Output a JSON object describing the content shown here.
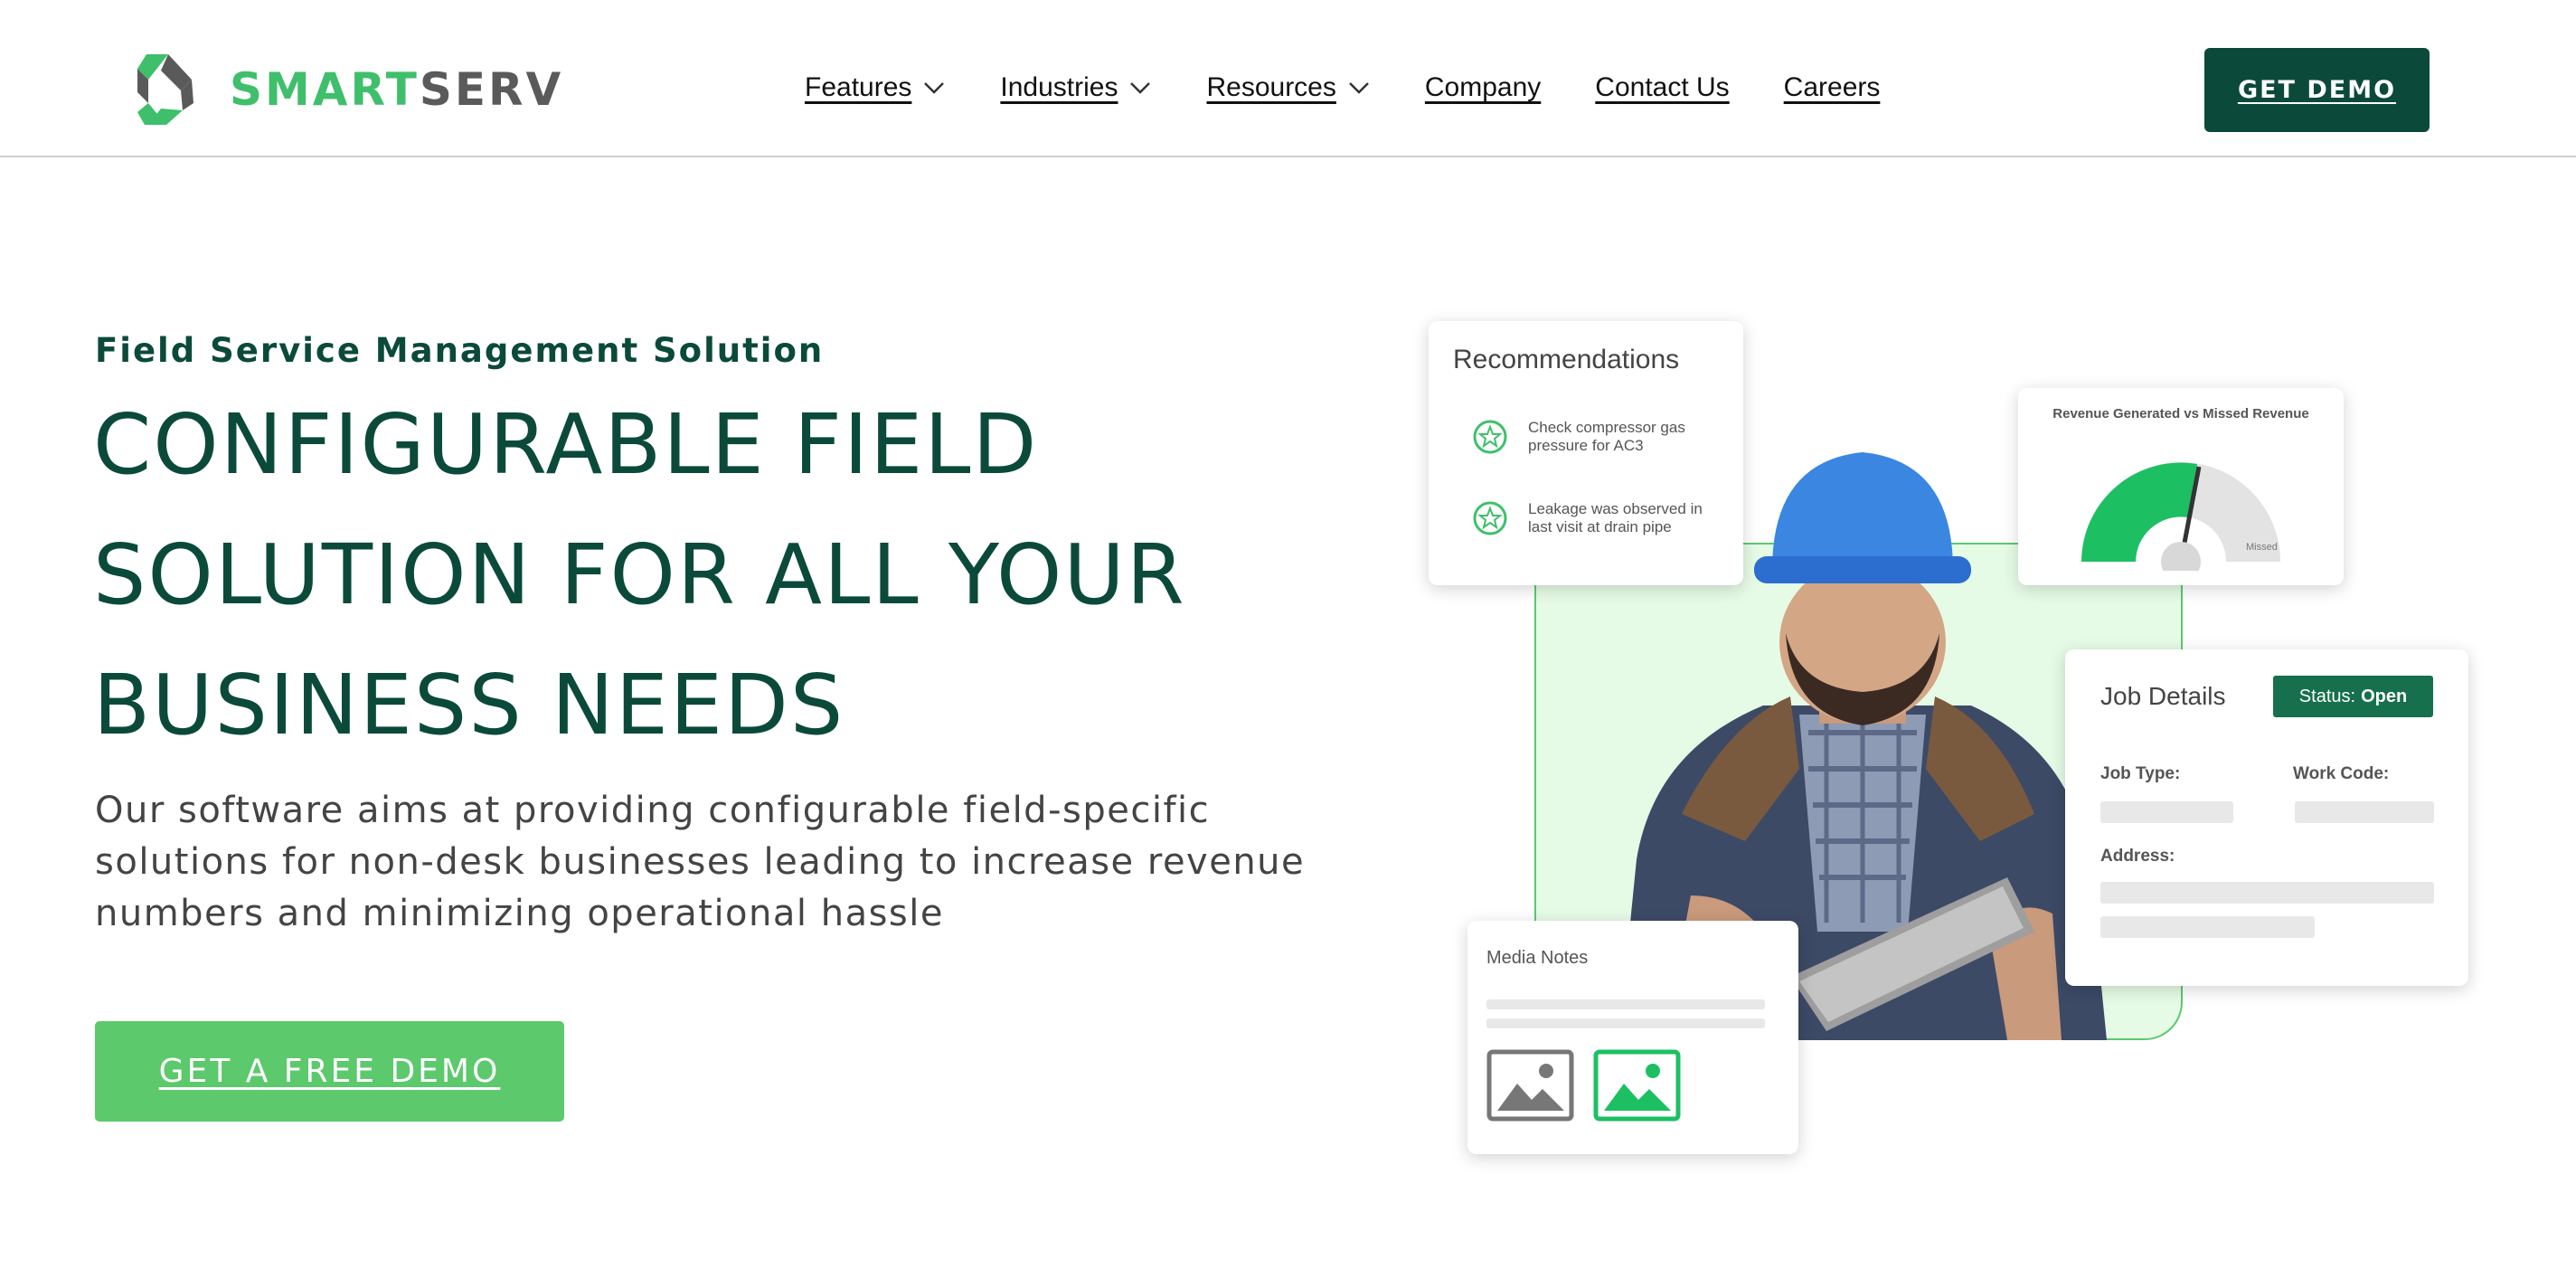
{
  "brand": {
    "name_part1": "SMART",
    "name_part2": "SERV",
    "accent": "#3fbf6b",
    "dark": "#0b4a3a"
  },
  "nav": {
    "items": [
      {
        "label": "Features",
        "has_dropdown": true
      },
      {
        "label": "Industries",
        "has_dropdown": true
      },
      {
        "label": "Resources",
        "has_dropdown": true
      },
      {
        "label": "Company",
        "has_dropdown": false
      },
      {
        "label": "Contact Us",
        "has_dropdown": false
      },
      {
        "label": "Careers",
        "has_dropdown": false
      }
    ],
    "cta": "GET DEMO"
  },
  "hero": {
    "eyebrow": "Field Service Management Solution",
    "headline_lines": [
      "CONFIGURABLE FIELD",
      "SOLUTION FOR ALL YOUR",
      "BUSINESS NEEDS"
    ],
    "description": "Our software aims at providing configurable field-specific solutions for non-desk businesses leading to increase revenue numbers and minimizing operational hassle",
    "cta": "GET A FREE DEMO"
  },
  "illustration": {
    "recommendations": {
      "title": "Recommendations",
      "items": [
        "Check compressor gas pressure for AC3",
        "Leakage was observed in last visit at drain pipe"
      ]
    },
    "revenue": {
      "title": "Revenue Generated vs Missed Revenue",
      "missed_label": "Missed"
    },
    "job_details": {
      "title": "Job Details",
      "status_label": "Status:",
      "status_value": "Open",
      "job_type_label": "Job Type:",
      "work_code_label": "Work Code:",
      "address_label": "Address:"
    },
    "media_notes": {
      "title": "Media Notes"
    }
  }
}
